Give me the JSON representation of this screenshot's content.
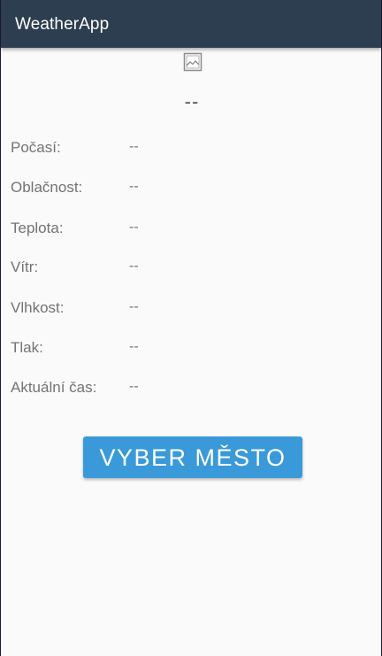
{
  "appbar": {
    "title": "WeatherApp"
  },
  "main": {
    "icon": "broken-image-icon",
    "city_name": "--",
    "rows": [
      {
        "label": "Počasí:",
        "value": "--"
      },
      {
        "label": "Oblačnost:",
        "value": "--"
      },
      {
        "label": "Teplota:",
        "value": "--"
      },
      {
        "label": "Vítr:",
        "value": "--"
      },
      {
        "label": "Vlhkost:",
        "value": "--"
      },
      {
        "label": "Tlak:",
        "value": "--"
      },
      {
        "label": "Aktuální čas:",
        "value": "--"
      }
    ],
    "select_city_label": "VYBER MĚSTO"
  },
  "colors": {
    "appbar": "#2d3e50",
    "accent": "#3a9ad9",
    "background": "#fafafa",
    "text": "#737373"
  }
}
